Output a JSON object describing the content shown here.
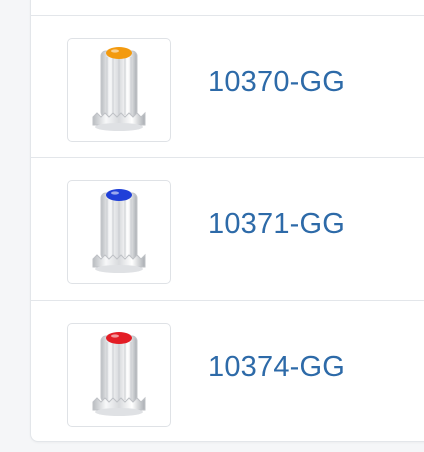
{
  "products": [
    {
      "sku": "10370-GG",
      "lens_color": "amber",
      "lens_hex": "#f39a0f"
    },
    {
      "sku": "10371-GG",
      "lens_color": "blue",
      "lens_hex": "#1f3fd8"
    },
    {
      "sku": "10374-GG",
      "lens_color": "red",
      "lens_hex": "#e31d25"
    }
  ]
}
